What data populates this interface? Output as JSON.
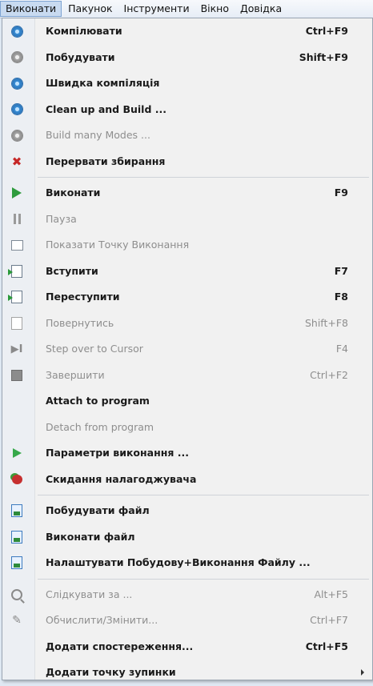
{
  "menubar": [
    {
      "label": "Виконати",
      "active": true
    },
    {
      "label": "Пакунок",
      "active": false
    },
    {
      "label": "Інструменти",
      "active": false
    },
    {
      "label": "Вікно",
      "active": false
    },
    {
      "label": "Довідка",
      "active": false
    }
  ],
  "menu": {
    "items": [
      {
        "label": "Компілювати",
        "shortcut": "Ctrl+F9",
        "icon": "gear-blue-icon",
        "enabled": true
      },
      {
        "label": "Побудувати",
        "shortcut": "Shift+F9",
        "icon": "gear-gray-icon",
        "enabled": true
      },
      {
        "label": "Швидка компіляція",
        "shortcut": "",
        "icon": "gear-blue-icon",
        "enabled": true
      },
      {
        "label": "Clean up and Build ...",
        "shortcut": "",
        "icon": "gear-blue-icon",
        "enabled": true
      },
      {
        "label": "Build many Modes ...",
        "shortcut": "",
        "icon": "gear-gray-icon",
        "enabled": false
      },
      {
        "label": "Перервати збирання",
        "shortcut": "",
        "icon": "abort-x-icon",
        "enabled": true
      },
      {
        "label": "Виконати",
        "shortcut": "F9",
        "icon": "play-icon",
        "enabled": true
      },
      {
        "label": "Пауза",
        "shortcut": "",
        "icon": "pause-icon",
        "enabled": false
      },
      {
        "label": "Показати Точку Виконання",
        "shortcut": "",
        "icon": "window-icon",
        "enabled": false
      },
      {
        "label": "Вступити",
        "shortcut": "F7",
        "icon": "step-into-icon",
        "enabled": true
      },
      {
        "label": "Переступити",
        "shortcut": "F8",
        "icon": "step-over-icon",
        "enabled": true
      },
      {
        "label": "Повернутись",
        "shortcut": "Shift+F8",
        "icon": "step-out-icon",
        "enabled": false
      },
      {
        "label": "Step over to Cursor",
        "shortcut": "F4",
        "icon": "step-to-cursor-icon",
        "enabled": false
      },
      {
        "label": "Завершити",
        "shortcut": "Ctrl+F2",
        "icon": "stop-icon",
        "enabled": false
      },
      {
        "label": "Attach to program",
        "shortcut": "",
        "icon": "",
        "enabled": true
      },
      {
        "label": "Detach from program",
        "shortcut": "",
        "icon": "",
        "enabled": false
      },
      {
        "label": "Параметри виконання ...",
        "shortcut": "",
        "icon": "run-params-icon",
        "enabled": true
      },
      {
        "label": "Скидання налагоджувача",
        "shortcut": "",
        "icon": "debugger-reset-icon",
        "enabled": true
      },
      {
        "label": "Побудувати файл",
        "shortcut": "",
        "icon": "build-file-icon",
        "enabled": true
      },
      {
        "label": "Виконати файл",
        "shortcut": "",
        "icon": "run-file-icon",
        "enabled": true
      },
      {
        "label": "Налаштувати Побудову+Виконання Файлу ...",
        "shortcut": "",
        "icon": "configure-file-icon",
        "enabled": true
      },
      {
        "label": "Слідкувати за ...",
        "shortcut": "Alt+F5",
        "icon": "inspect-icon",
        "enabled": false
      },
      {
        "label": "Обчислити/Змінити...",
        "shortcut": "Ctrl+F7",
        "icon": "evaluate-icon",
        "enabled": false
      },
      {
        "label": "Додати спостереження...",
        "shortcut": "Ctrl+F5",
        "icon": "",
        "enabled": true
      },
      {
        "label": "Додати точку зупинки",
        "shortcut": "",
        "icon": "",
        "enabled": true,
        "submenu": true
      }
    ]
  }
}
